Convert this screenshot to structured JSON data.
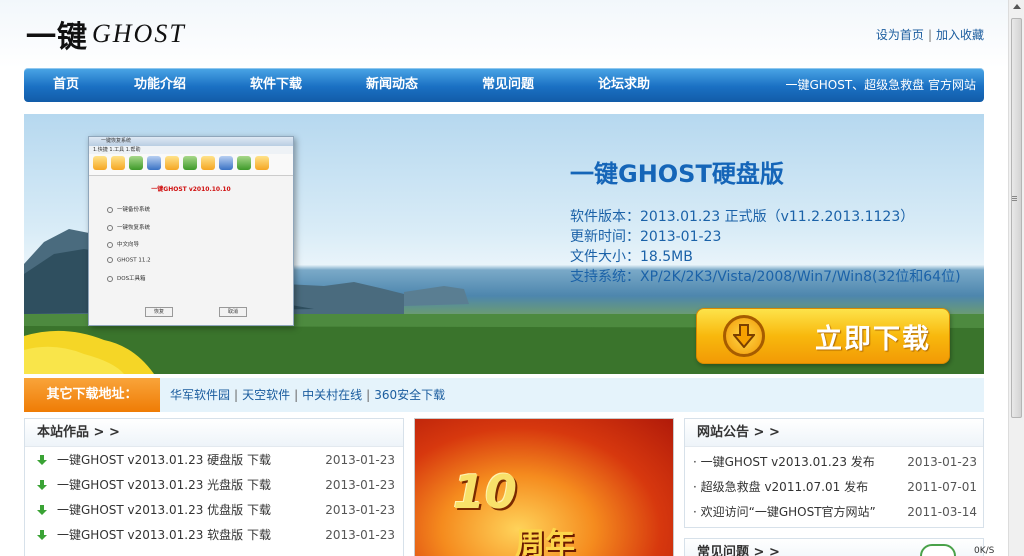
{
  "header": {
    "logo_cn": "一键",
    "logo_en": "GHOST",
    "set_home": "设为首页",
    "separator": "|",
    "add_favorite": "加入收藏"
  },
  "nav": {
    "items": [
      "首页",
      "功能介绍",
      "软件下载",
      "新闻动态",
      "常见问题",
      "论坛求助"
    ],
    "slogan": "一键GHOST、超级急救盘 官方网站"
  },
  "banner": {
    "title": "一键GHOST硬盘版",
    "info": [
      "软件版本：2013.01.23 正式版（v11.2.2013.1123）",
      "更新时间：2013-01-23",
      "文件大小：18.5MB",
      "支持系统：XP/2K/2K3/Vista/2008/Win7/Win8(32位和64位)"
    ],
    "download_label": "立即下载",
    "app_window": {
      "title": "一键恢复系统",
      "menu": "1.快捷   1.工具   1.帮助",
      "version": "一键GHOST v2010.10.10",
      "options": [
        "一键备份系统",
        "一键恢复系统",
        "中文向导",
        "GHOST 11.2",
        "DOS工具箱"
      ],
      "ok": "恢复",
      "cancel": "取消"
    }
  },
  "alt_downloads": {
    "label": "其它下载地址：",
    "links": [
      "华军软件园",
      "天空软件",
      "中关村在线",
      "360安全下载"
    ]
  },
  "works": {
    "title": "本站作品 > >",
    "items": [
      {
        "title": "一键GHOST v2013.01.23 硬盘版 下载",
        "date": "2013-01-23"
      },
      {
        "title": "一键GHOST v2013.01.23 光盘版 下载",
        "date": "2013-01-23"
      },
      {
        "title": "一键GHOST v2013.01.23 优盘版 下载",
        "date": "2013-01-23"
      },
      {
        "title": "一键GHOST v2013.01.23 软盘版 下载",
        "date": "2013-01-23"
      }
    ]
  },
  "promo": {
    "number": "10",
    "text": "周年"
  },
  "notices": {
    "title": "网站公告 > >",
    "items": [
      {
        "title": "· 一键GHOST v2013.01.23 发布",
        "date": "2013-01-23"
      },
      {
        "title": "· 超级急救盘 v2011.07.01 发布",
        "date": "2011-07-01"
      },
      {
        "title": "· 欢迎访问“一键GHOST官方网站”",
        "date": "2011-03-14"
      }
    ]
  },
  "faq": {
    "title": "常见问题 > >"
  },
  "status": {
    "speed": "0K/S"
  },
  "colors": {
    "nav_blue": "#1a70c3",
    "link_blue": "#1a5c9e",
    "orange": "#ef7c05",
    "download_yellow": "#f8b80d",
    "arrow_green": "#3aa335"
  }
}
